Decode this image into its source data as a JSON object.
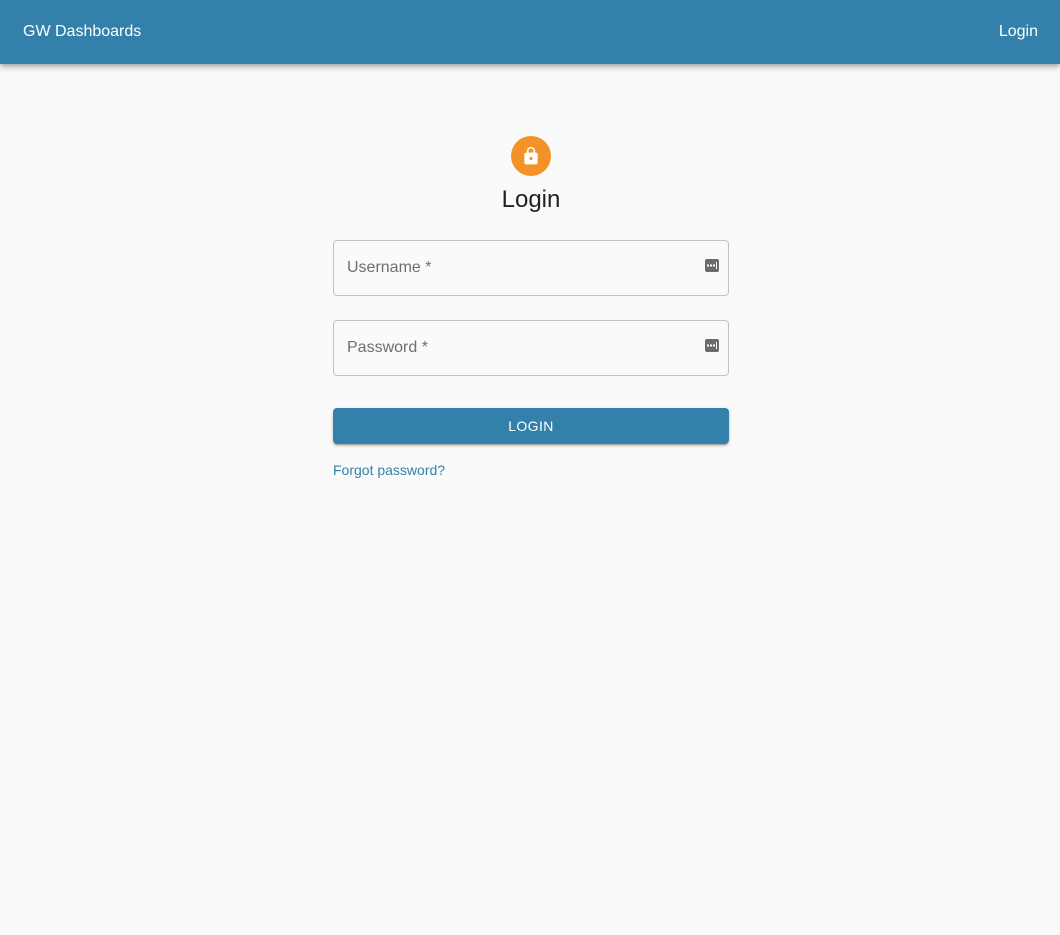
{
  "appbar": {
    "title": "GW Dashboards",
    "login_link": "Login"
  },
  "form": {
    "lock_icon": "lock-icon",
    "heading": "Login",
    "username": {
      "label": "Username *",
      "value": "",
      "icon": "password-manager-icon"
    },
    "password": {
      "label": "Password *",
      "value": "",
      "icon": "password-manager-icon"
    },
    "submit_label": "LOGIN",
    "forgot_link": "Forgot password?"
  },
  "colors": {
    "primary": "#3380aa",
    "avatar": "#f39229",
    "background": "#fafafa"
  }
}
